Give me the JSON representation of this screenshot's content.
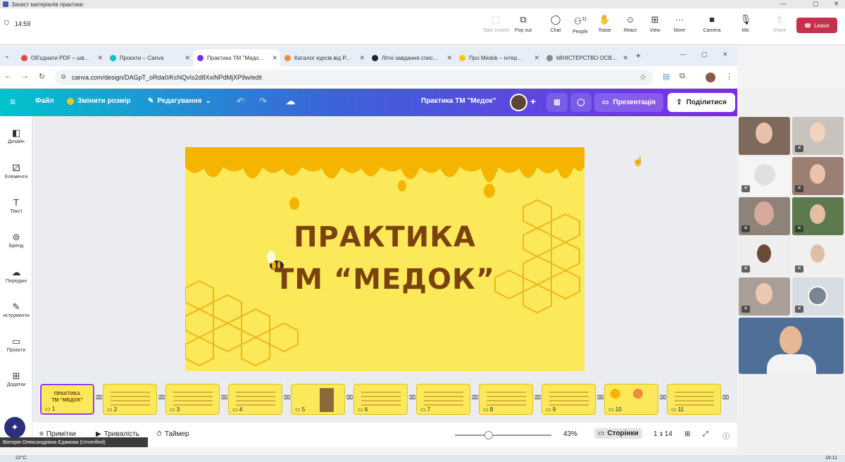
{
  "window": {
    "title": "Захист матеріалів практики"
  },
  "teams": {
    "timer": "14:59",
    "buttons": [
      {
        "label": "Take control",
        "icon": "take-control-icon",
        "disabled": true
      },
      {
        "label": "Pop out",
        "icon": "pop-out-icon"
      },
      {
        "label": "Chat",
        "icon": "chat-icon"
      },
      {
        "label": "People",
        "icon": "people-icon",
        "badge": "11"
      },
      {
        "label": "Raise",
        "icon": "raise-hand-icon"
      },
      {
        "label": "React",
        "icon": "react-icon"
      },
      {
        "label": "View",
        "icon": "view-icon"
      },
      {
        "label": "More",
        "icon": "more-icon"
      },
      {
        "label": "Camera",
        "icon": "camera-icon"
      },
      {
        "label": "Mic",
        "icon": "mic-icon"
      },
      {
        "label": "Share",
        "icon": "share-icon",
        "disabled": true
      }
    ],
    "leave_label": "Leave",
    "leave_color": "#c4314b"
  },
  "browser": {
    "tabs": [
      {
        "title": "Об'єднати PDF – шв...",
        "color": "#e34a3a"
      },
      {
        "title": "Проєкти – Canva",
        "color": "#00c4cc"
      },
      {
        "title": "Практика ТМ \"Медо...",
        "color": "#7d2ae8",
        "active": true
      },
      {
        "title": "Каталог курсів від Р...",
        "color": "#f08a3c"
      },
      {
        "title": "Літні завдання спис...",
        "color": "#222222"
      },
      {
        "title": "Про Medok – інтер...",
        "color": "#f5c518"
      },
      {
        "title": "МІНІСТЕРСТВО ОСВ...",
        "color": "#666666"
      }
    ],
    "url": "canva.com/design/DAGpT_oRda0/KcNQvIs2d8XxiNPdMjXP9w/edit"
  },
  "canva": {
    "menu": {
      "file": "Файл",
      "resize": "Змінити розмір",
      "edit": "Редагування"
    },
    "design_title": "Практика ТМ \"Медок\"",
    "present_label": "Презентація",
    "share_label": "Поділитися",
    "sidebar": [
      {
        "label": "Дизайн",
        "icon": "design-icon"
      },
      {
        "label": "Елементи",
        "icon": "elements-icon"
      },
      {
        "label": "Текст",
        "icon": "text-icon"
      },
      {
        "label": "Бренд",
        "icon": "brand-icon"
      },
      {
        "label": "Передані",
        "icon": "uploads-icon"
      },
      {
        "label": "нструменти",
        "icon": "tools-icon"
      },
      {
        "label": "Проєкти",
        "icon": "projects-icon"
      },
      {
        "label": "Додатки",
        "icon": "apps-icon"
      }
    ],
    "slide": {
      "line1": "ПРАКТИКА",
      "line2": "ТМ “МЕДОК”"
    },
    "thumb1": {
      "line1": "ПРАКТИКА",
      "line2": "ТМ “МЕДОК”"
    },
    "pages": [
      "1",
      "2",
      "3",
      "4",
      "5",
      "6",
      "7",
      "8",
      "9",
      "10",
      "11"
    ],
    "bottom": {
      "notes": "Примітки",
      "duration": "Тривалість",
      "timer": "Таймер",
      "zoom": "43%",
      "zoom_level": 0.35,
      "pages_label": "Сторінки",
      "page_counter": "1 з 14"
    }
  },
  "nameplate": "Вікторія Олександрівна Єдамова (Unverified)",
  "taskbar": {
    "temp": "22°C",
    "time": "16:11"
  }
}
